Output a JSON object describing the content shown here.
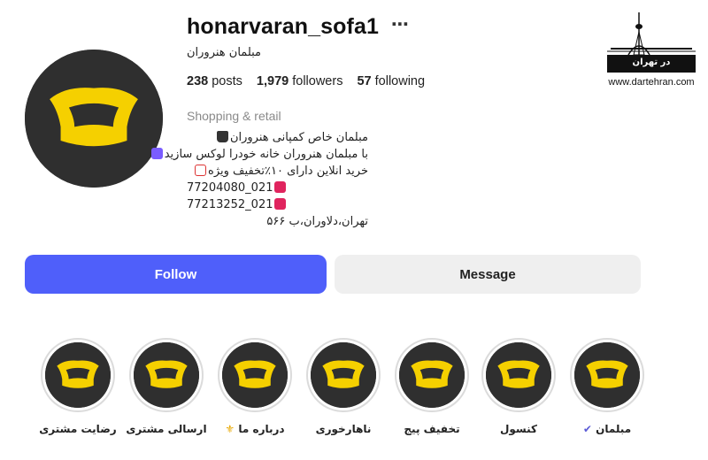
{
  "profile": {
    "username": "honarvaran_sofa1",
    "more_icon": "⋯",
    "display_name": "مبلمان هنروران",
    "stats": {
      "posts_count": "238",
      "posts_label": "posts",
      "followers_count": "1,979",
      "followers_label": "followers",
      "following_count": "57",
      "following_label": "following"
    },
    "category": "Shopping & retail",
    "bio": {
      "line1": "مبلمان خاص کمپانی هنروران",
      "line2": "با مبلمان هنروران خانه خودرا لوکس سازید",
      "line3": "خرید انلاین دارای ۱۰٪تخفیف ویژه",
      "phone1": "77204080_021",
      "phone2": "77213252_021",
      "address": "تهران،دلاوران،ب ۵۶۶"
    }
  },
  "actions": {
    "follow_label": "Follow",
    "message_label": "Message"
  },
  "highlights": [
    {
      "label": "رضایت مشتری"
    },
    {
      "label": "ارسالی مشتری"
    },
    {
      "label": "درباره ما"
    },
    {
      "label": "ناهارخوری"
    },
    {
      "label": "تخفیف پیج"
    },
    {
      "label": "کنسول"
    },
    {
      "label": "مبلمان"
    }
  ],
  "watermark": {
    "logo_text": "در تهران",
    "url": "www.dartehran.com"
  },
  "colors": {
    "follow_button": "#4f5ffa",
    "message_button": "#efefef",
    "logo_background": "#2f2f2f",
    "logo_sofa": "#f5d000",
    "category_text": "#8a8a8a"
  },
  "icons": {
    "avatar": "sofa-logo-icon",
    "highlight": "sofa-logo-icon",
    "more": "more-options-icon",
    "watermark": "milad-tower-icon"
  }
}
